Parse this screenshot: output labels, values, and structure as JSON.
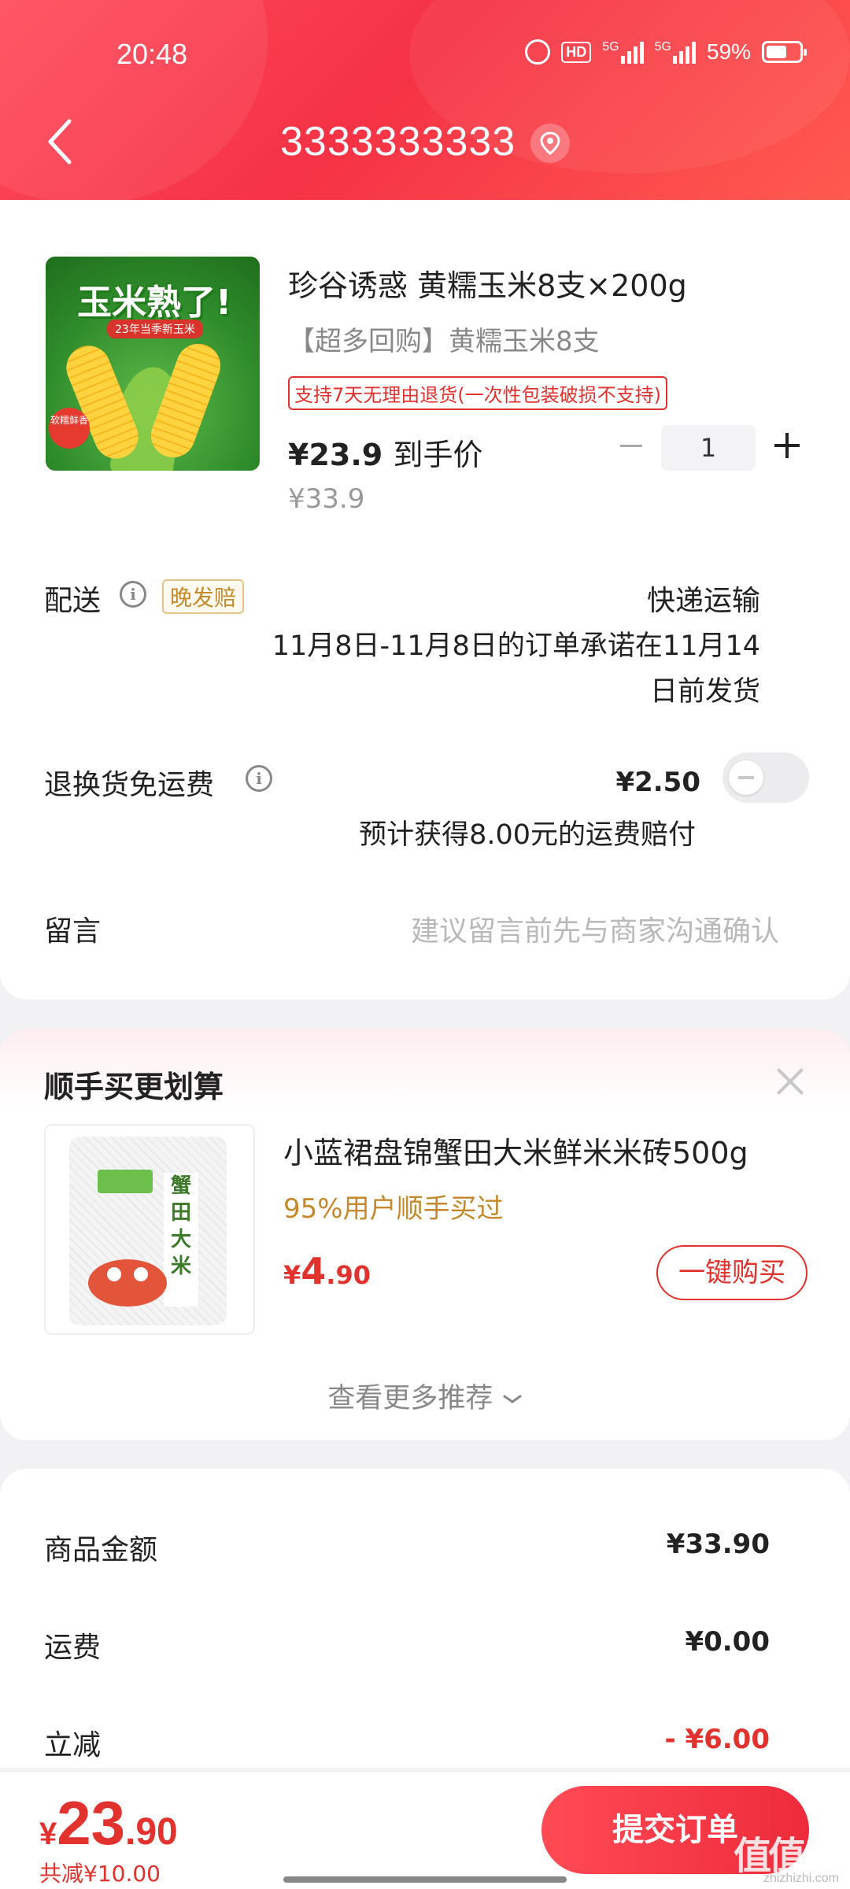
{
  "status_bar": {
    "time": "20:48",
    "hd_label": "HD",
    "signal1_label": "5G",
    "signal2_label": "5G",
    "battery": "59%"
  },
  "header": {
    "title": "3333333333"
  },
  "product": {
    "image_title": "玉米熟了!",
    "image_subtitle": "23年当季新玉米",
    "image_badge": "软糯鲜香",
    "title": "珍谷诱惑 黄糯玉米8支×200g",
    "subtitle": "【超多回购】黄糯玉米8支",
    "return_policy": "支持7天无理由退货(一次性包装破损不支持)",
    "price": "¥23.9",
    "price_label": "到手价",
    "original_price": "¥33.9",
    "quantity": "1"
  },
  "delivery": {
    "label": "配送",
    "late_tag": "晚发赔",
    "method": "快递运输",
    "promise": "11月8日-11月8日的订单承诺在11月14日前发货"
  },
  "freight_insurance": {
    "label": "退换货免运费",
    "price": "¥2.50",
    "note": "预计获得8.00元的运费赔付",
    "enabled": false
  },
  "message": {
    "label": "留言",
    "placeholder": "建议留言前先与商家沟通确认"
  },
  "recommend": {
    "title": "顺手买更划算",
    "item": {
      "image_label": "蟹田大米",
      "title": "小蓝裙盘锦蟹田大米鲜米米砖500g",
      "stat": "95%用户顺手买过",
      "price_symbol": "¥",
      "price_int": "4",
      "price_dec": ".90",
      "buy_label": "一键购买"
    },
    "more_label": "查看更多推荐"
  },
  "summary": {
    "goods_label": "商品金额",
    "goods_value": "¥33.90",
    "shipping_label": "运费",
    "shipping_value": "¥0.00",
    "discount_label": "立减",
    "discount_value": "- ¥6.00"
  },
  "footer": {
    "total_symbol": "¥",
    "total_int": "23",
    "total_dec": ".90",
    "discount_note": "共减¥10.00",
    "submit_label": "提交订单"
  },
  "watermark": {
    "text": "值值值",
    "url": "zhizhizhi.com"
  },
  "colors": {
    "accent": "#e2322e",
    "header": "#f53246",
    "gold": "#c5882a"
  }
}
